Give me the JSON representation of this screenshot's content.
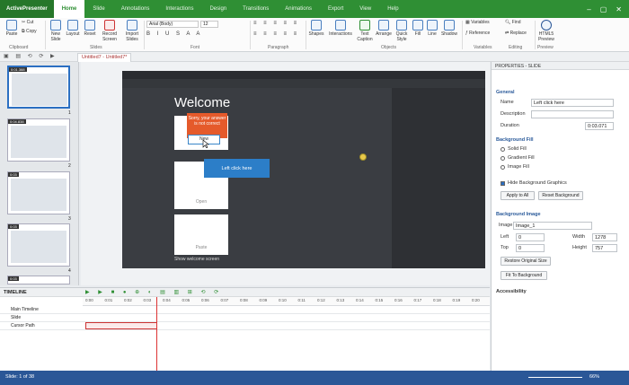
{
  "app": {
    "name": "ActivePresenter",
    "doc_tab": "Untitled7 - Untitled7*"
  },
  "menu_tabs": [
    "Home",
    "Slide",
    "Annotations",
    "Interactions",
    "Design",
    "Transitions",
    "Animations",
    "Export",
    "View",
    "Help"
  ],
  "ribbon": {
    "clipboard": {
      "paste": "Paste",
      "cut": "Cut",
      "copy": "Copy",
      "group": "Clipboard"
    },
    "slides": {
      "new": "New Slide",
      "layout": "Layout",
      "reset": "Reset",
      "record": "Record Screen",
      "import": "Import Slides",
      "group": "Slides"
    },
    "font": {
      "name": "Arial (Body)",
      "size": "12",
      "group": "Font"
    },
    "paragraph": {
      "group": "Paragraph"
    },
    "objects": {
      "shapes": "Shapes",
      "interactions": "Interactions",
      "caption": "Text Caption",
      "arrange": "Arrange",
      "quickstyle": "Quick Style",
      "fill": "Fill",
      "line": "Line",
      "shadow": "Shadow",
      "group": "Objects"
    },
    "variables": {
      "variables": "Variables",
      "reference": "Reference",
      "group": "Variables"
    },
    "editing": {
      "find": "Find",
      "replace": "Replace",
      "group": "Editing"
    },
    "preview": {
      "html5": "HTML5 Preview",
      "group": "Preview"
    }
  },
  "slides": [
    {
      "time": "0:01.388",
      "num": "1"
    },
    {
      "time": "0:04.838",
      "num": "2"
    },
    {
      "time": "0:03",
      "num": "3"
    },
    {
      "time": "0:03",
      "num": "4"
    },
    {
      "time": "0:03",
      "num": "5"
    }
  ],
  "canvas": {
    "welcome": "Welcome",
    "callout": "Sorry, your answer is not correct",
    "new_btn": "New",
    "click_box": "Left click here",
    "open": "Open",
    "paste": "Paste",
    "show_welcome": "Show welcome screen"
  },
  "timeline": {
    "title": "TIMELINE",
    "rows": [
      "Main Timeline",
      "Slide",
      "Cursor Path"
    ],
    "ticks": [
      "0:00",
      "0:01",
      "0:02",
      "0:03",
      "0:04",
      "0:05",
      "0:06",
      "0:07",
      "0:08",
      "0:09",
      "0:10",
      "0:11",
      "0:12",
      "0:13",
      "0:14",
      "0:15",
      "0:16",
      "0:17",
      "0:18",
      "0:19",
      "0:20"
    ]
  },
  "properties": {
    "title": "PROPERTIES - SLIDE",
    "general": "General",
    "name_label": "Name",
    "name_value": "Left click here",
    "description_label": "Description",
    "duration_label": "Duration",
    "duration_value": "0:03.071",
    "bgfill": "Background Fill",
    "solid": "Solid Fill",
    "gradient": "Gradient Fill",
    "image": "Image Fill",
    "hide_bg": "Hide Background Graphics",
    "apply_all": "Apply to All",
    "reset_bg": "Reset Background",
    "bgimage": "Background Image",
    "image_label": "Image",
    "image_value": "Image_1",
    "left_label": "Left",
    "left_value": "0",
    "top_label": "Top",
    "top_value": "0",
    "width_label": "Width",
    "width_value": "1278",
    "height_label": "Height",
    "height_value": "757",
    "restore": "Restore Original Size",
    "fit": "Fit To Background",
    "accessibility": "Accessibility"
  },
  "status": {
    "slide": "Slide: 1 of 38",
    "zoom": "66%"
  }
}
